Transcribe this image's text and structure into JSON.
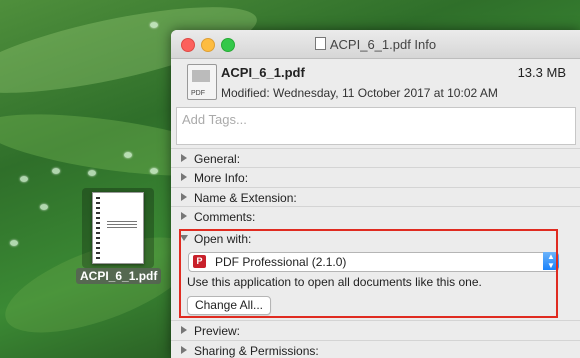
{
  "desktop": {
    "file_label": "ACPI_6_1.pdf"
  },
  "window": {
    "title": "ACPI_6_1.pdf Info",
    "file_name": "ACPI_6_1.pdf",
    "file_size": "13.3 MB",
    "file_icon_text": "PDF",
    "modified": "Modified: Wednesday, 11 October 2017 at 10:02 AM",
    "tags_placeholder": "Add Tags...",
    "sections": {
      "general": "General:",
      "more_info": "More Info:",
      "name_extension": "Name & Extension:",
      "comments": "Comments:",
      "open_with": "Open with:",
      "preview": "Preview:",
      "sharing": "Sharing & Permissions:"
    },
    "open_with": {
      "app_icon_glyph": "P",
      "app": "PDF Professional (2.1.0)",
      "hint": "Use this application to open all documents like this one.",
      "change_all": "Change All..."
    }
  },
  "colors": {
    "annotation_red": "#e02b20",
    "close": "#fc605c",
    "minimize": "#fdbc40",
    "zoom": "#34c84a"
  }
}
